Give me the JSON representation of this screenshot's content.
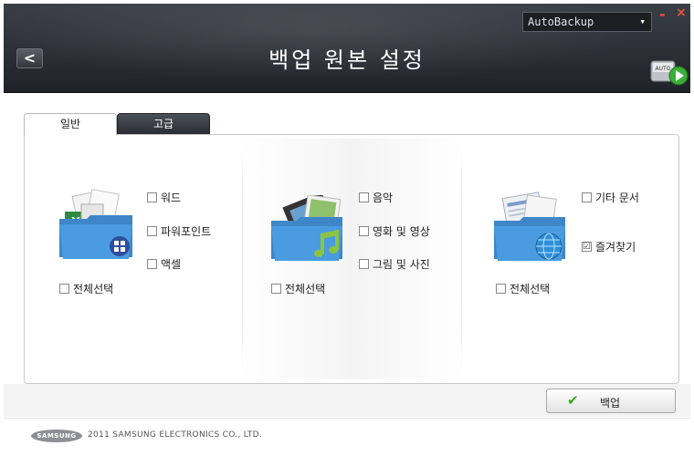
{
  "header": {
    "title": "백업 원본 설정",
    "back_glyph": "<",
    "profile_select": {
      "value": "AutoBackup"
    },
    "minimize_glyph": "-",
    "close_glyph": "×",
    "auto_badge_label": "AUTO"
  },
  "tabs": [
    {
      "label": "일반",
      "active": true
    },
    {
      "label": "고급",
      "active": false
    }
  ],
  "columns": [
    {
      "icon": "documents-folder-icon",
      "options": [
        {
          "label": "워드",
          "checked": false
        },
        {
          "label": "파워포인트",
          "checked": false
        },
        {
          "label": "액셀",
          "checked": false
        }
      ],
      "select_all": {
        "label": "전체선택",
        "checked": false
      }
    },
    {
      "icon": "media-folder-icon",
      "options": [
        {
          "label": "음악",
          "checked": false
        },
        {
          "label": "영화 및 영상",
          "checked": false
        },
        {
          "label": "그림 및 사진",
          "checked": false
        }
      ],
      "select_all": {
        "label": "전체선택",
        "checked": false
      }
    },
    {
      "icon": "web-folder-icon",
      "options": [
        {
          "label": "기타 문서",
          "checked": false
        },
        {
          "label": "즐겨찾기",
          "checked": true
        }
      ],
      "select_all": {
        "label": "전체선택",
        "checked": false
      }
    }
  ],
  "backup_button": {
    "label": "백업"
  },
  "footer": {
    "logo_text": "SAMSUNG",
    "copyright": "2011 SAMSUNG ELECTRONICS CO., LTD."
  },
  "check_glyphs": {
    "checked": "☑",
    "unchecked": ""
  },
  "colors": {
    "header_bg": "#2b2f36",
    "accent_red": "#e9523a",
    "check_green": "#35a820"
  }
}
